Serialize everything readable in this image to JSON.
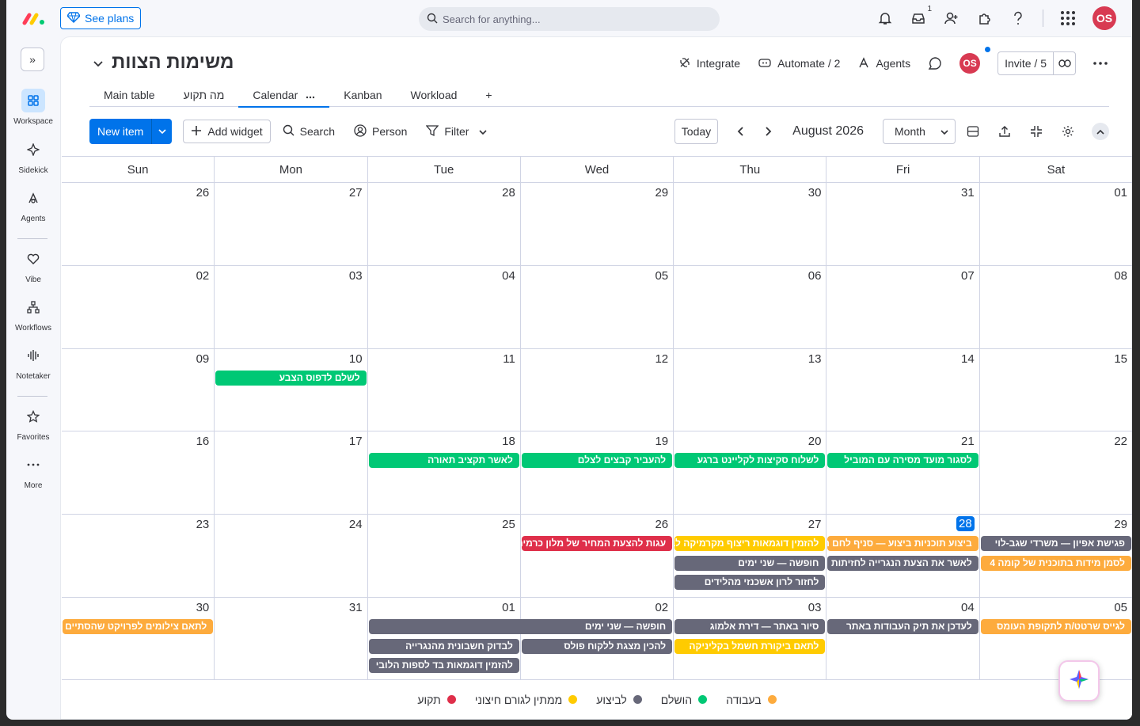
{
  "topbar": {
    "see_plans": "See plans",
    "search_placeholder": "Search for anything...",
    "inbox_count": "1",
    "user_initials": "OS"
  },
  "sidebar": {
    "items": [
      {
        "label": "Workspace",
        "icon": "grid-icon"
      },
      {
        "label": "Sidekick",
        "icon": "sparkle-icon"
      },
      {
        "label": "Agents",
        "icon": "agents-icon"
      },
      {
        "label": "Vibe",
        "icon": "heart-icon"
      },
      {
        "label": "Workflows",
        "icon": "workflow-icon"
      },
      {
        "label": "Notetaker",
        "icon": "waveform-icon"
      },
      {
        "label": "Favorites",
        "icon": "star-icon"
      },
      {
        "label": "More",
        "icon": "dots-icon"
      }
    ]
  },
  "board": {
    "title": "משימות הצוות",
    "integrate": "Integrate",
    "automate": "Automate / 2",
    "agents": "Agents",
    "avatar": "OS",
    "invite": "Invite / 5",
    "tabs": [
      "Main table",
      "מה תקוע",
      "Calendar",
      "Kanban",
      "Workload"
    ],
    "add_tab": "+"
  },
  "toolbar": {
    "new_item": "New item",
    "add_widget": "Add widget",
    "search": "Search",
    "person": "Person",
    "filter": "Filter",
    "today": "Today",
    "month_label": "August 2026",
    "view_select": "Month"
  },
  "calendar": {
    "weekdays": [
      "Sun",
      "Mon",
      "Tue",
      "Wed",
      "Thu",
      "Fri",
      "Sat"
    ],
    "days": [
      "26",
      "27",
      "28",
      "29",
      "30",
      "31",
      "01",
      "02",
      "03",
      "04",
      "05",
      "06",
      "07",
      "08",
      "09",
      "10",
      "11",
      "12",
      "13",
      "14",
      "15",
      "16",
      "17",
      "18",
      "19",
      "20",
      "21",
      "22",
      "23",
      "24",
      "25",
      "26",
      "27",
      "28",
      "29",
      "30",
      "31",
      "01",
      "02",
      "03",
      "04",
      "05"
    ],
    "today_index": 33,
    "events": [
      {
        "text": "לשלם לדפוס הצבע",
        "row": 2,
        "col": 1,
        "span": 1,
        "slot": 0,
        "status": "done"
      },
      {
        "text": "לאשר תקציב תאורה",
        "row": 3,
        "col": 2,
        "span": 1,
        "slot": 0,
        "status": "done"
      },
      {
        "text": "להעביר קבצים לצלם",
        "row": 3,
        "col": 3,
        "span": 1,
        "slot": 0,
        "status": "done"
      },
      {
        "text": "לשלוח סקיצות לקליינט ברגע",
        "row": 3,
        "col": 4,
        "span": 1,
        "slot": 0,
        "status": "done"
      },
      {
        "text": "לסגור מועד מסירה עם המוביל",
        "row": 3,
        "col": 5,
        "span": 1,
        "slot": 0,
        "status": "done"
      },
      {
        "text": "עגות להצעת המחיר של מלון כרמים",
        "row": 4,
        "col": 3,
        "span": 1,
        "slot": 0,
        "status": "stuck"
      },
      {
        "text": "להזמין דוגמאות ריצוף מקרמיקה לבנה",
        "row": 4,
        "col": 4,
        "span": 1,
        "slot": 0,
        "status": "waiting"
      },
      {
        "text": "חופשה — שני ימים",
        "row": 4,
        "col": 4,
        "span": 1,
        "slot": 1,
        "status": "progress"
      },
      {
        "text": "לחזור לרון אשכנזי מהלידים",
        "row": 4,
        "col": 4,
        "span": 1,
        "slot": 2,
        "status": "progress"
      },
      {
        "text": "ביצוע תוכניות ביצוע — סניף לחם הארץ",
        "row": 4,
        "col": 5,
        "span": 1,
        "slot": 0,
        "status": "working"
      },
      {
        "text": "לאשר את הצעת הנגרייה לחזיתות",
        "row": 4,
        "col": 5,
        "span": 1,
        "slot": 1,
        "status": "progress"
      },
      {
        "text": "פגישת אפיון — משרדי שגב-לוי",
        "row": 4,
        "col": 6,
        "span": 1,
        "slot": 0,
        "status": "progress"
      },
      {
        "text": "לסמן מידות בתוכנית של קומה 4",
        "row": 4,
        "col": 6,
        "span": 1,
        "slot": 1,
        "status": "working"
      },
      {
        "text": "לתאם צילומים לפרויקט שהסתיים",
        "row": 5,
        "col": 0,
        "span": 1,
        "slot": 0,
        "status": "working"
      },
      {
        "text": "חופשה — שני ימים",
        "row": 5,
        "col": 2,
        "span": 2,
        "slot": 0,
        "status": "progress"
      },
      {
        "text": "לבדוק חשבונית מהנגרייה",
        "row": 5,
        "col": 2,
        "span": 1,
        "slot": 1,
        "status": "progress"
      },
      {
        "text": "להזמין דוגמאות בד לספות הלובי",
        "row": 5,
        "col": 2,
        "span": 1,
        "slot": 2,
        "status": "progress"
      },
      {
        "text": "להכין מצגת ללקוח פולס",
        "row": 5,
        "col": 3,
        "span": 1,
        "slot": 1,
        "status": "progress"
      },
      {
        "text": "סיור באתר — דירת אלמוג",
        "row": 5,
        "col": 4,
        "span": 1,
        "slot": 0,
        "status": "progress"
      },
      {
        "text": "לתאם ביקורת חשמל בקליניקה",
        "row": 5,
        "col": 4,
        "span": 1,
        "slot": 1,
        "status": "waiting"
      },
      {
        "text": "לעדכן את תיק העבודות באתר",
        "row": 5,
        "col": 5,
        "span": 1,
        "slot": 0,
        "status": "progress"
      },
      {
        "text": "לגייס שרטט/ת לתקופת העומס",
        "row": 5,
        "col": 6,
        "span": 1,
        "slot": 0,
        "status": "working"
      }
    ]
  },
  "status_colors": {
    "working": "#fdab3d",
    "done": "#00c875",
    "progress": "#676879",
    "waiting": "#ffcb00",
    "stuck": "#df2f4a"
  },
  "legend": [
    {
      "label": "בעבודה",
      "status": "working"
    },
    {
      "label": "הושלם",
      "status": "done"
    },
    {
      "label": "לביצוע",
      "status": "progress"
    },
    {
      "label": "ממתין לגורם חיצוני",
      "status": "waiting"
    },
    {
      "label": "תקוע",
      "status": "stuck"
    }
  ]
}
